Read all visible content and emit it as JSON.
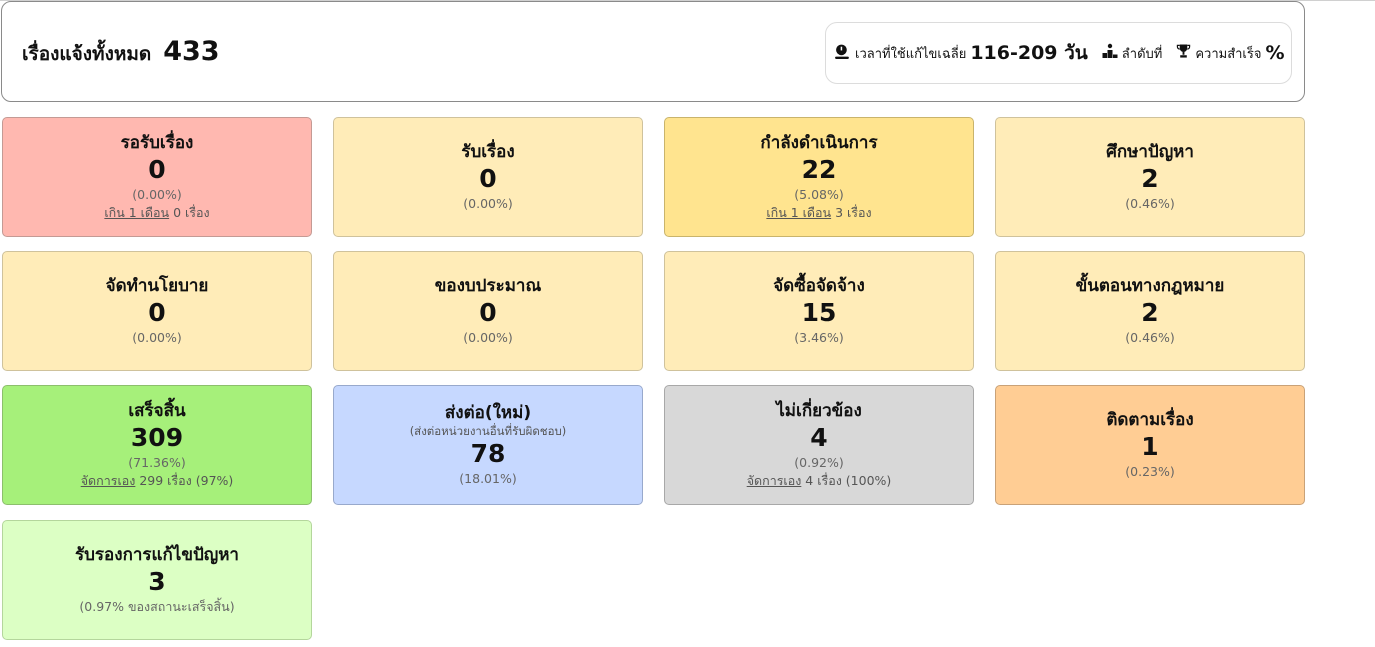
{
  "header": {
    "total_label": "เรื่องแจ้งทั้งหมด",
    "total_count": "433",
    "avg_time_label": "เวลาที่ใช้แก้ไขเฉลี่ย",
    "avg_time_value": "116-209 วัน",
    "rank_label": "ลำดับที่",
    "success_label": "ความสำเร็จ",
    "success_value": "%",
    "icons": [
      "stopwatch-icon",
      "podium-icon",
      "trophy-icon"
    ]
  },
  "cards": [
    {
      "title": "รอรับเรื่อง",
      "count": "0",
      "pct": "(0.00%)",
      "link": "เกิน 1 เดือน",
      "extra": " 0 เรื่อง",
      "color": "#ffb8b0"
    },
    {
      "title": "รับเรื่อง",
      "count": "0",
      "pct": "(0.00%)",
      "color": "#ffecb8"
    },
    {
      "title": "กำลังดำเนินการ",
      "count": "22",
      "pct": "(5.08%)",
      "link": "เกิน 1 เดือน",
      "extra": " 3 เรื่อง",
      "color": "#ffe48f"
    },
    {
      "title": "ศึกษาปัญหา",
      "count": "2",
      "pct": "(0.46%)",
      "color": "#ffecb8"
    },
    {
      "title": "จัดทำนโยบาย",
      "count": "0",
      "pct": "(0.00%)",
      "color": "#ffecb8"
    },
    {
      "title": "ของบประมาณ",
      "count": "0",
      "pct": "(0.00%)",
      "color": "#ffecb8"
    },
    {
      "title": "จัดซื้อจัดจ้าง",
      "count": "15",
      "pct": "(3.46%)",
      "color": "#ffecb8"
    },
    {
      "title": "ขั้นตอนทางกฎหมาย",
      "count": "2",
      "pct": "(0.46%)",
      "color": "#ffecb8"
    },
    {
      "title": "เสร็จสิ้น",
      "count": "309",
      "pct": "(71.36%)",
      "link": "จัดการเอง",
      "extra": " 299 เรื่อง (97%)",
      "color": "#a6f07a"
    },
    {
      "title": "ส่งต่อ(ใหม่)",
      "subtitle": "(ส่งต่อหน่วยงานอื่นที่รับผิดชอบ)",
      "count": "78",
      "pct": "(18.01%)",
      "color": "#c6d8ff"
    },
    {
      "title": "ไม่เกี่ยวข้อง",
      "count": "4",
      "pct": "(0.92%)",
      "link": "จัดการเอง",
      "extra": " 4 เรื่อง (100%)",
      "color": "#d8d8d8"
    },
    {
      "title": "ติดตามเรื่อง",
      "count": "1",
      "pct": "(0.23%)",
      "color": "#ffcd94"
    },
    {
      "title": "รับรองการแก้ไขปัญหา",
      "count": "3",
      "pct": "(0.97% ของสถานะเสร็จสิ้น)",
      "color": "#dcffc4"
    }
  ]
}
